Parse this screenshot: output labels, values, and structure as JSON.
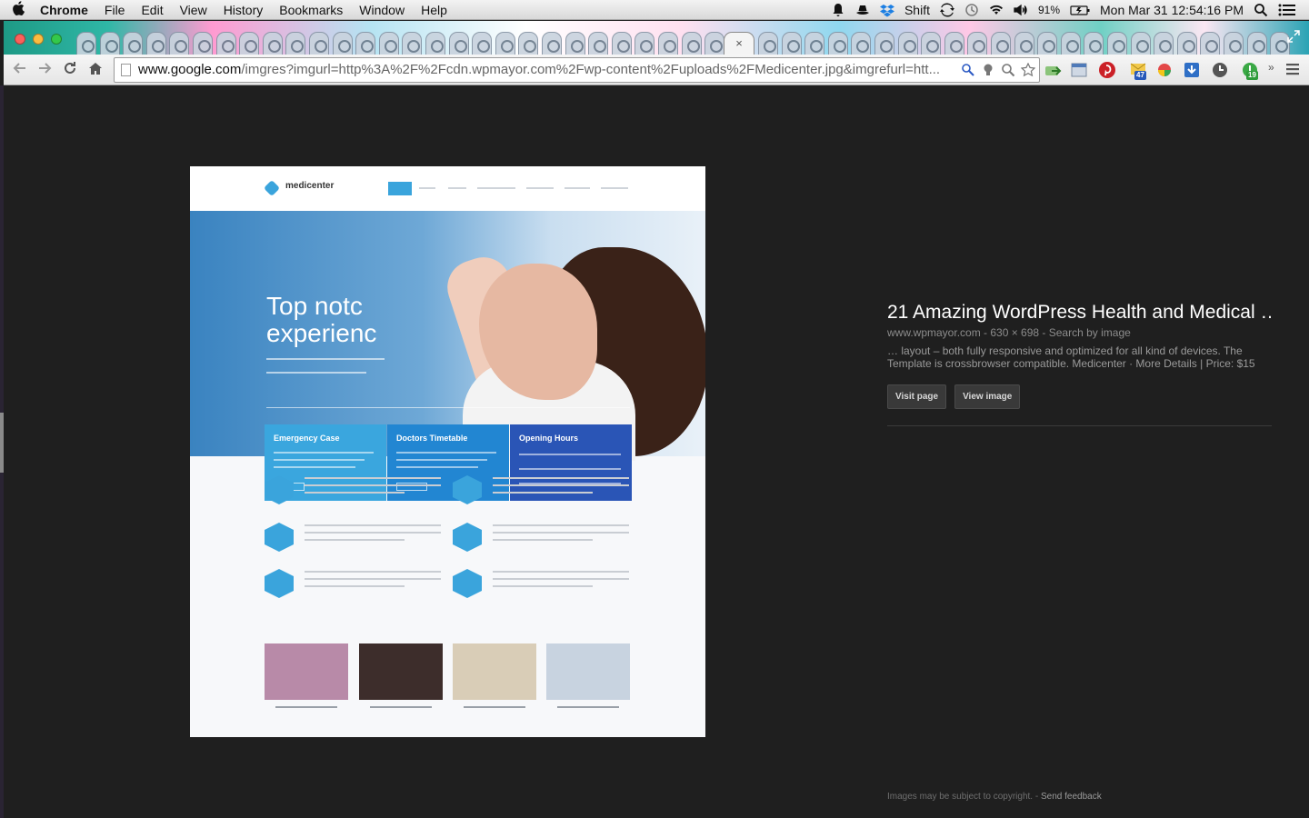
{
  "menubar": {
    "app": "Chrome",
    "items": [
      "File",
      "Edit",
      "View",
      "History",
      "Bookmarks",
      "Window",
      "Help"
    ],
    "shift_label": "Shift",
    "battery": "91%",
    "clock": "Mon Mar 31  12:54:16 PM"
  },
  "tabs": {
    "active_close": "×"
  },
  "toolbar": {
    "url_host": "www.google.com",
    "url_rest": "/imgres?imgurl=http%3A%2F%2Fcdn.wpmayor.com%2Fwp-content%2Fuploads%2FMedicenter.jpg&imgrefurl=htt...",
    "badge_mail": "47",
    "badge_ext": "19"
  },
  "preview": {
    "logo_text": "medicenter",
    "hero_title_1": "Top notc",
    "hero_title_2": "experienc",
    "box1": "Emergency Case",
    "box2": "Doctors Timetable",
    "box3": "Opening Hours"
  },
  "info": {
    "title": "21 Amazing WordPress Health and Medical …",
    "meta": "www.wpmayor.com - 630 × 698 - Search by image",
    "description": "… layout – both fully responsive and optimized for all kind of devices. The Template is crossbrowser compatible. Medicenter · More Details | Price: $15",
    "visit_label": "Visit page",
    "view_label": "View image"
  },
  "footer": {
    "copyright": "Images may be subject to copyright. - ",
    "feedback": "Send feedback"
  }
}
